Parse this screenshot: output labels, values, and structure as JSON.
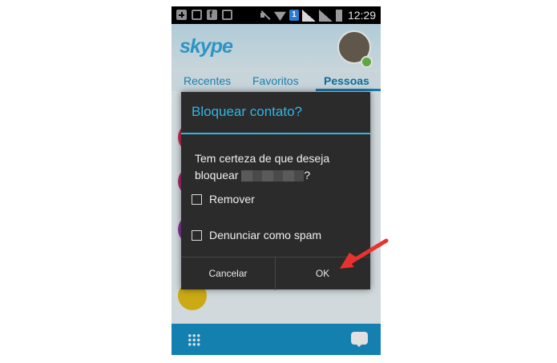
{
  "status_bar": {
    "time": "12:29",
    "badge": "1"
  },
  "app": {
    "logo": "skype",
    "tabs": [
      {
        "label": "Recentes"
      },
      {
        "label": "Favoritos"
      },
      {
        "label": "Pessoas"
      }
    ]
  },
  "dialog": {
    "title": "Bloquear contato?",
    "message_line1": "Tem certeza de que deseja",
    "message_line2_prefix": "bloquear",
    "message_line2_suffix": "?",
    "options": [
      {
        "label": "Remover",
        "checked": false
      },
      {
        "label": "Denunciar como spam",
        "checked": false
      }
    ],
    "cancel_label": "Cancelar",
    "ok_label": "OK"
  },
  "colors": {
    "accent": "#32b5e5",
    "arrow": "#e8322f",
    "bottom_bar": "#1792c9"
  }
}
